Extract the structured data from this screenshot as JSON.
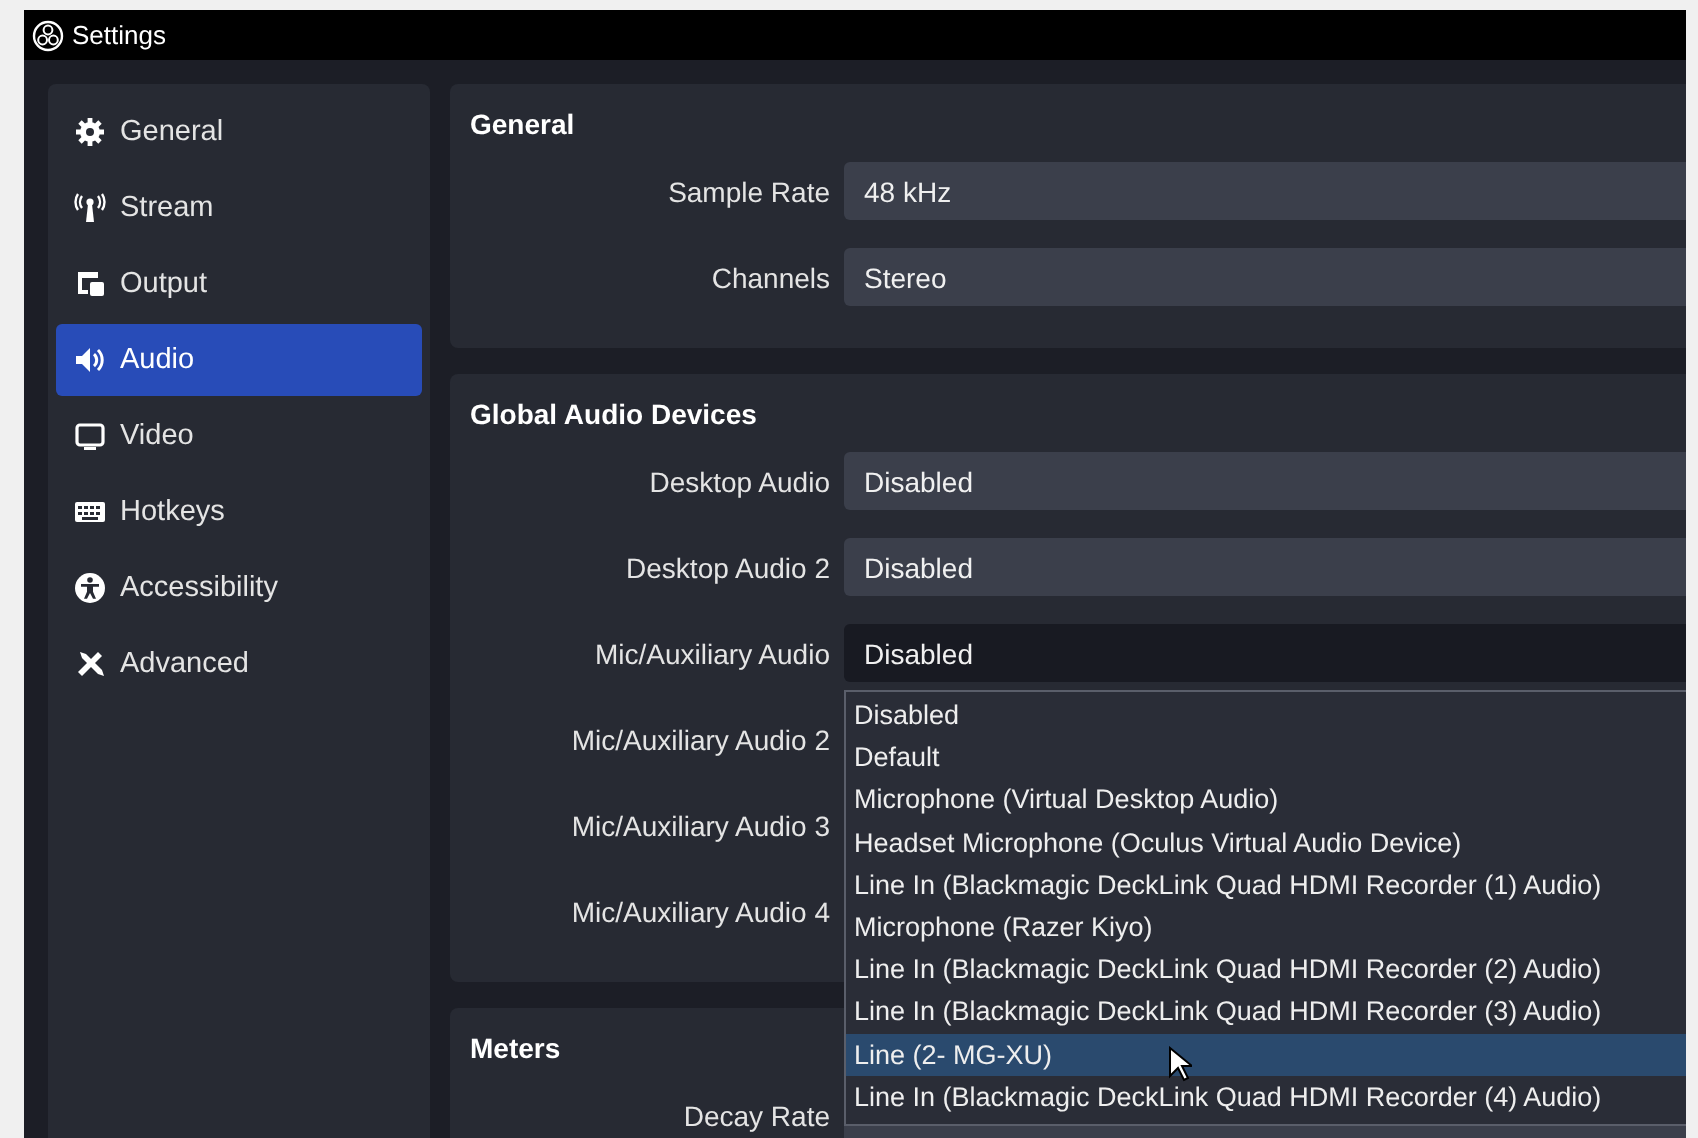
{
  "window": {
    "title": "Settings"
  },
  "sidebar": {
    "items": [
      {
        "label": "General",
        "selected": false
      },
      {
        "label": "Stream",
        "selected": false
      },
      {
        "label": "Output",
        "selected": false
      },
      {
        "label": "Audio",
        "selected": true
      },
      {
        "label": "Video",
        "selected": false
      },
      {
        "label": "Hotkeys",
        "selected": false
      },
      {
        "label": "Accessibility",
        "selected": false
      },
      {
        "label": "Advanced",
        "selected": false
      }
    ]
  },
  "sections": [
    {
      "title": "General",
      "rows": [
        {
          "label": "Sample Rate",
          "value": "48 kHz",
          "focused": false
        },
        {
          "label": "Channels",
          "value": "Stereo",
          "focused": false
        }
      ]
    },
    {
      "title": "Global Audio Devices",
      "rows": [
        {
          "label": "Desktop Audio",
          "value": "Disabled",
          "focused": false
        },
        {
          "label": "Desktop Audio 2",
          "value": "Disabled",
          "focused": false
        },
        {
          "label": "Mic/Auxiliary Audio",
          "value": "Disabled",
          "focused": true
        },
        {
          "label": "Mic/Auxiliary Audio 2"
        },
        {
          "label": "Mic/Auxiliary Audio 3"
        },
        {
          "label": "Mic/Auxiliary Audio 4"
        }
      ]
    },
    {
      "title": "Meters",
      "rows": [
        {
          "label": "Decay Rate"
        }
      ]
    }
  ],
  "dropdown": {
    "options": [
      {
        "label": "Disabled",
        "selected": false
      },
      {
        "label": "Default",
        "selected": false
      },
      {
        "label": "Microphone (Virtual Desktop Audio)",
        "selected": false
      },
      {
        "label": "Headset Microphone (Oculus Virtual Audio Device)",
        "selected": false
      },
      {
        "label": "Line In (Blackmagic DeckLink Quad HDMI Recorder (1) Audio)",
        "selected": false
      },
      {
        "label": "Microphone (Razer Kiyo)",
        "selected": false
      },
      {
        "label": "Line In (Blackmagic DeckLink Quad HDMI Recorder (2) Audio)",
        "selected": false
      },
      {
        "label": "Line In (Blackmagic DeckLink Quad HDMI Recorder (3) Audio)",
        "selected": false
      },
      {
        "label": "Line (2- MG-XU)",
        "selected": true
      },
      {
        "label": "Line In (Blackmagic DeckLink Quad HDMI Recorder (4) Audio)",
        "selected": false
      }
    ]
  }
}
